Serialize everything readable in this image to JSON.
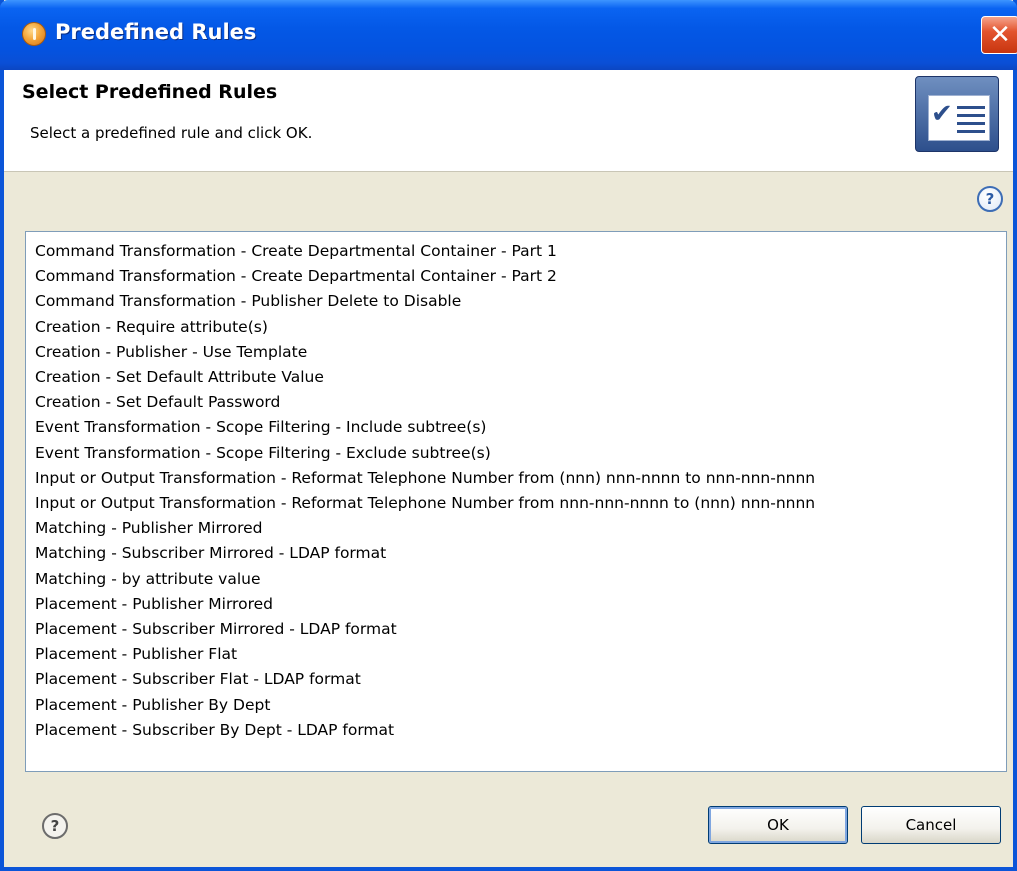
{
  "window": {
    "title": "Predefined Rules",
    "close_label": "✕"
  },
  "header": {
    "title": "Select Predefined Rules",
    "subtitle": "Select a predefined rule and click OK."
  },
  "rules": [
    "Command Transformation - Create Departmental Container - Part 1",
    "Command Transformation - Create Departmental Container - Part 2",
    "Command Transformation - Publisher Delete to Disable",
    "Creation - Require attribute(s)",
    "Creation - Publisher - Use Template",
    "Creation - Set Default Attribute Value",
    "Creation - Set Default Password",
    "Event Transformation - Scope Filtering - Include subtree(s)",
    "Event Transformation - Scope Filtering - Exclude subtree(s)",
    "Input or Output Transformation - Reformat Telephone Number from (nnn) nnn-nnnn to nnn-nnn-nnnn",
    "Input or Output Transformation - Reformat Telephone Number from nnn-nnn-nnnn to (nnn) nnn-nnnn",
    "Matching - Publisher Mirrored",
    "Matching - Subscriber Mirrored - LDAP format",
    "Matching - by attribute value",
    "Placement - Publisher Mirrored",
    "Placement - Subscriber Mirrored - LDAP format",
    "Placement - Publisher Flat",
    "Placement - Subscriber Flat - LDAP format",
    "Placement - Publisher By Dept",
    "Placement - Subscriber By Dept - LDAP format"
  ],
  "buttons": {
    "ok_label": "OK",
    "cancel_label": "Cancel",
    "help_glyph": "?"
  },
  "colors": {
    "titlebar": "#0458e6",
    "dialog_bg": "#ece9d8",
    "close": "#e3542e",
    "list_border": "#7f9db9"
  },
  "icons": {
    "app": "app-orb-icon",
    "banner": "checklist-icon",
    "help": "help-icon",
    "close": "close-icon"
  }
}
